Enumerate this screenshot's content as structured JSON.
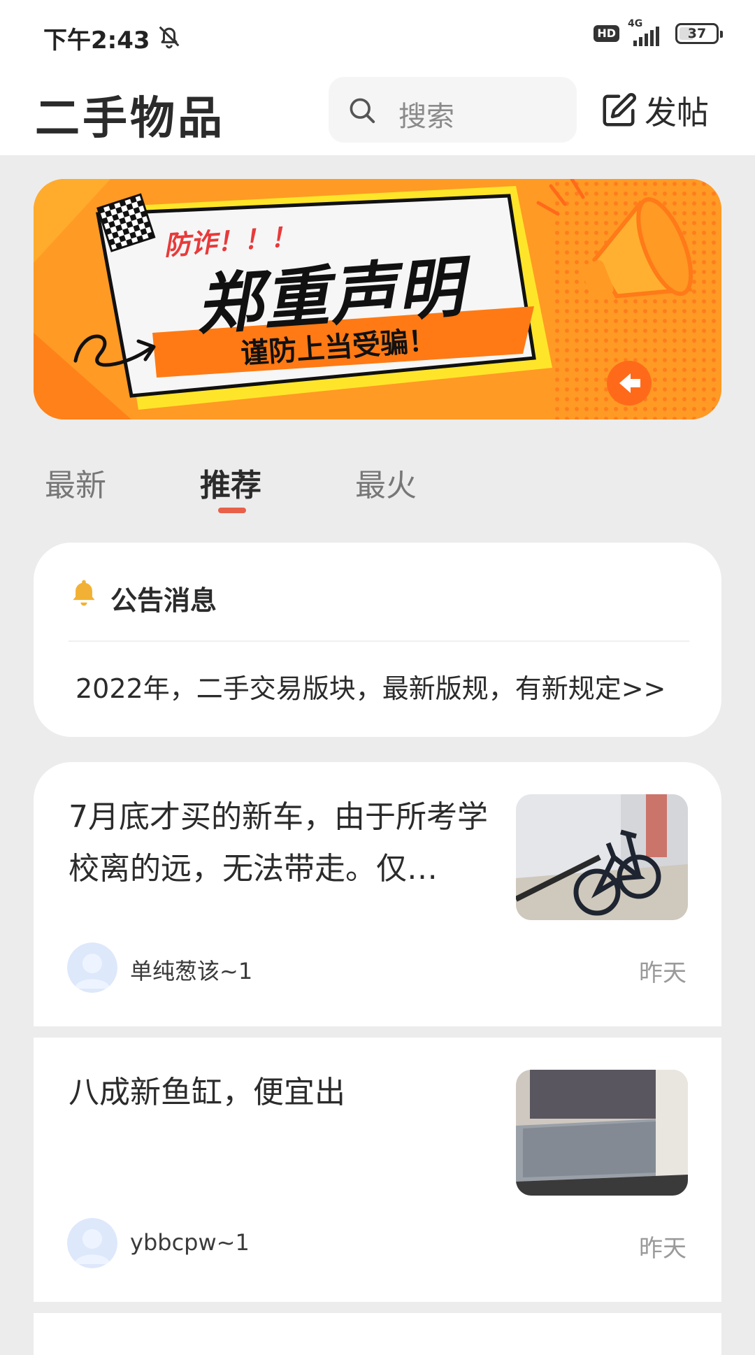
{
  "status_bar": {
    "time": "下午2:43",
    "hd": "HD",
    "network": "4G",
    "battery": "37"
  },
  "header": {
    "title": "二手物品",
    "search_placeholder": "搜索",
    "post_label": "发帖"
  },
  "banner": {
    "tag": "防诈！！！",
    "headline": "郑重声明",
    "subline": "谨防上当受骗！"
  },
  "tabs": [
    {
      "label": "最新",
      "active": false
    },
    {
      "label": "推荐",
      "active": true
    },
    {
      "label": "最火",
      "active": false
    }
  ],
  "notice": {
    "title": "公告消息",
    "text": "2022年，二手交易版块，最新版规，有新规定>>"
  },
  "posts": [
    {
      "title": "7月底才买的新车，由于所考学校离的远，无法带走。仅…",
      "author": "单纯葱该~1",
      "time": "昨天"
    },
    {
      "title": "八成新鱼缸，便宜出",
      "author": "ybbcpw~1",
      "time": "昨天"
    }
  ],
  "colors": {
    "accent": "#e8604a",
    "banner_orange": "#ff8a1f",
    "bell_yellow": "#f2b134"
  }
}
